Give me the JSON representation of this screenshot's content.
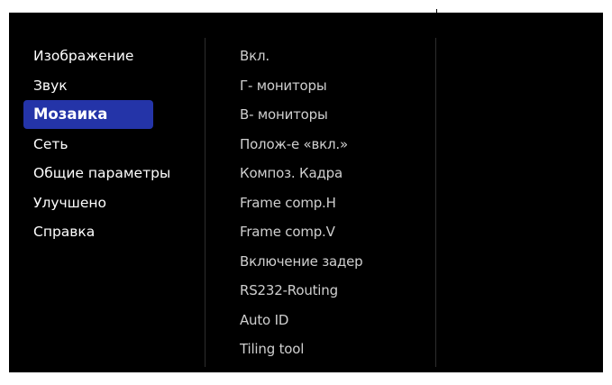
{
  "main_menu": {
    "items": [
      {
        "label": "Изображение",
        "selected": false
      },
      {
        "label": "Звук",
        "selected": false
      },
      {
        "label": "Мозаика",
        "selected": true
      },
      {
        "label": "Сеть",
        "selected": false
      },
      {
        "label": "Общие параметры",
        "selected": false
      },
      {
        "label": "Улучшено",
        "selected": false
      },
      {
        "label": "Справка",
        "selected": false
      }
    ]
  },
  "sub_menu": {
    "items": [
      {
        "label": "Вкл."
      },
      {
        "label": "Г- мониторы"
      },
      {
        "label": "В- мониторы"
      },
      {
        "label": "Полож-е «вкл.»"
      },
      {
        "label": "Композ. Кадра"
      },
      {
        "label": "Frame comp.H"
      },
      {
        "label": "Frame comp.V"
      },
      {
        "label": "Включение задер"
      },
      {
        "label": "RS232-Routing"
      },
      {
        "label": "Auto ID"
      },
      {
        "label": "Tiling tool"
      }
    ]
  },
  "colors": {
    "background": "#000000",
    "selection": "#2434a8",
    "main_text": "#ffffff",
    "sub_text": "#cfcfcf"
  }
}
